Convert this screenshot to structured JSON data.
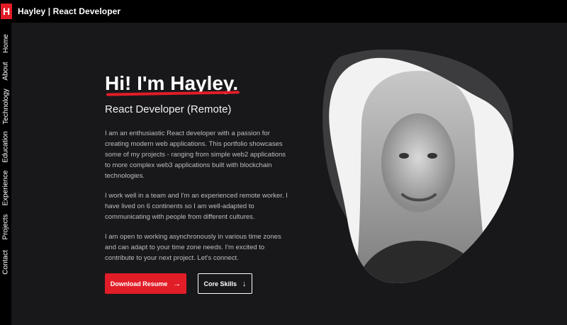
{
  "header": {
    "logo_letter": "H",
    "title": "Hayley | React Developer"
  },
  "sidebar": {
    "items": [
      {
        "label": "Home"
      },
      {
        "label": "About"
      },
      {
        "label": "Technology"
      },
      {
        "label": "Education"
      },
      {
        "label": "Experience"
      },
      {
        "label": "Projects"
      },
      {
        "label": "Contact"
      }
    ]
  },
  "hero": {
    "headline": "Hi! I'm Hayley.",
    "subtitle": "React Developer (Remote)",
    "paragraphs": [
      "I am an enthusiastic React developer with a passion for creating modern web applications. This portfolio showcases some of my projects - ranging from simple web2 applications to more complex web3 applications built with blockchain technologies.",
      "I work well in a team and I'm an experienced remote worker. I have lived on 6 continents so I am well-adapted to communicating with people from different cultures.",
      "I am open to working asynchronously in various time zones and can adapt to your time zone needs. I'm excited to contribute to your next project. Let's connect."
    ],
    "buttons": {
      "download_label": "Download Resume",
      "skills_label": "Core Skills"
    }
  },
  "colors": {
    "accent": "#e11d27",
    "background": "#18181b",
    "bar": "#000000"
  }
}
